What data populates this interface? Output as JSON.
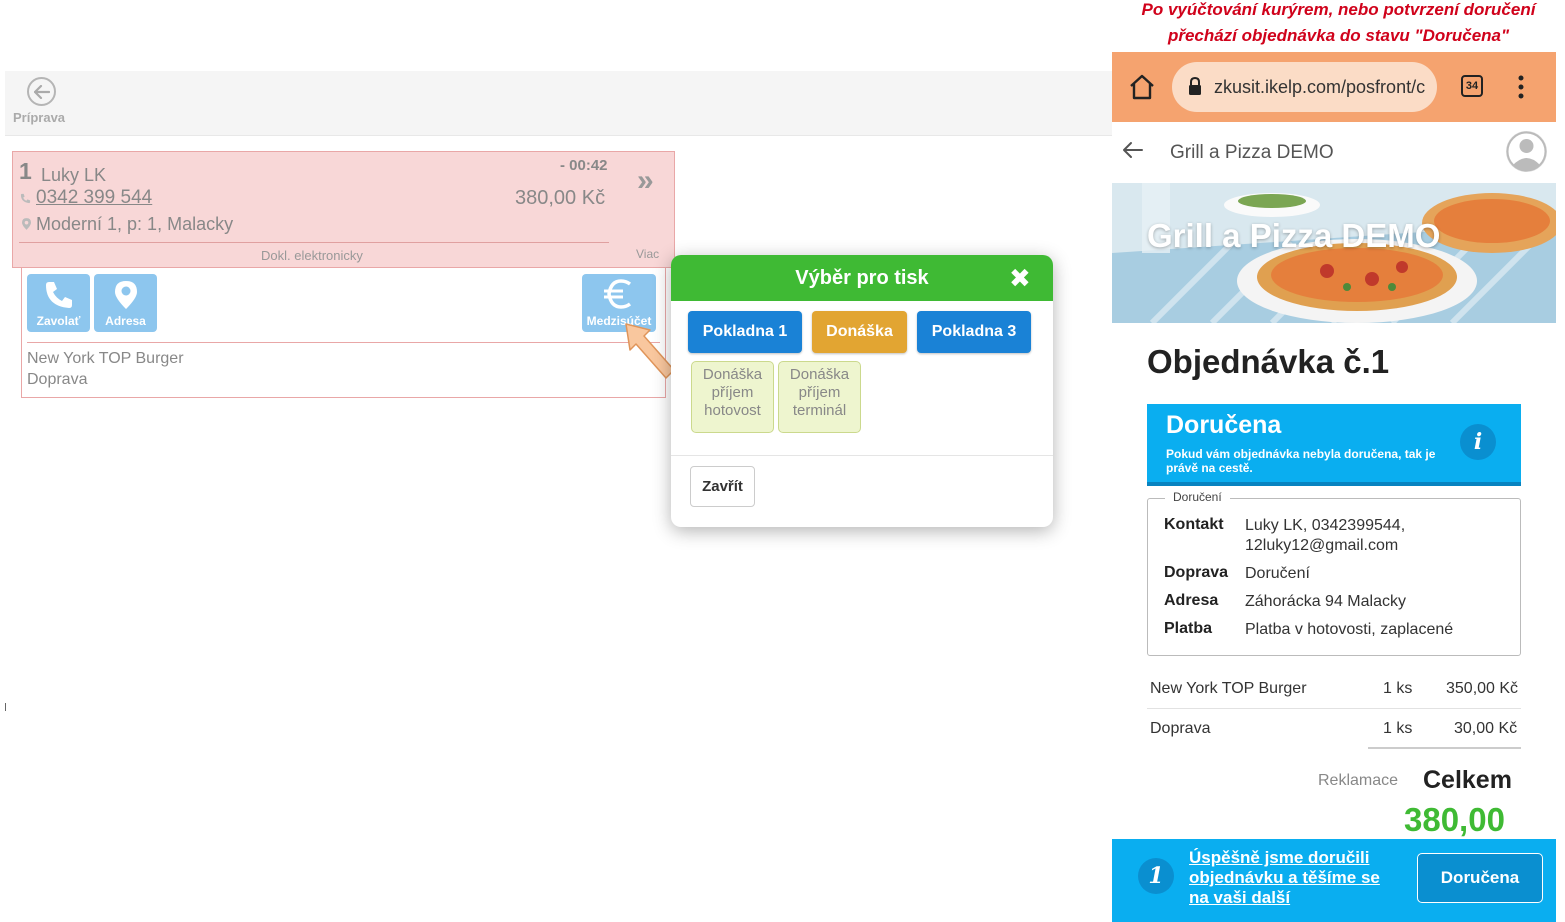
{
  "pos": {
    "back_label": "Príprava",
    "order": {
      "number": "1",
      "name": "Luky LK",
      "time": "- 00:42",
      "phone": "0342 399 544",
      "price": "380,00 Kč",
      "address": "Moderní 1, p: 1, Malacky",
      "doc": "Dokl. elektronicky",
      "more": "Viac",
      "chevron": "»"
    },
    "tiles": {
      "call": "Zavolať",
      "address": "Adresa",
      "subtotal": "Medzisúčet"
    },
    "items": [
      "New York TOP Burger",
      "Doprava"
    ]
  },
  "modal": {
    "title": "Výběr pro tisk",
    "close_icon": "✖",
    "buttons": [
      "Pokladna 1",
      "Donáška",
      "Pokladna 3"
    ],
    "options": [
      [
        "Donáška",
        "příjem",
        "hotovost"
      ],
      [
        "Donáška",
        "příjem",
        "terminál"
      ]
    ],
    "close_label": "Zavřít",
    "colors": {
      "header": "#3fba34",
      "blue": "#1a82d6",
      "orange": "#e2a532"
    }
  },
  "mobile": {
    "note_line1": "Po vyúčtování kurýrem, nebo potvrzení doručení",
    "note_line2": "přechází objednávka do stavu \"Doručena\"",
    "url": "zkusit.ikelp.com/posfront/c",
    "tabs_count": "34",
    "app_title": "Grill a Pizza DEMO",
    "banner_title": "Grill a Pizza DEMO",
    "order_title": "Objednávka č.1",
    "status": {
      "title": "Doručena",
      "subtitle": "Pokud vám objednávka nebyla doručena, tak je právě na cestě.",
      "info_icon": "i"
    },
    "delivery": {
      "legend": "Doručení",
      "rows": [
        {
          "label": "Kontakt",
          "value1": "Luky LK, 0342399544,",
          "value2": "12luky12@gmail.com"
        },
        {
          "label": "Doprava",
          "value1": "Doručení",
          "value2": ""
        },
        {
          "label": "Adresa",
          "value1": "Záhorácka 94 Malacky",
          "value2": ""
        },
        {
          "label": "Platba",
          "value1": "Platba v hotovosti, zaplacené",
          "value2": ""
        }
      ]
    },
    "items": [
      {
        "name": "New York TOP Burger",
        "qty": "1 ks",
        "price": "350,00 Kč"
      },
      {
        "name": "Doprava",
        "qty": "1 ks",
        "price": "30,00 Kč"
      }
    ],
    "reklamace": "Reklamace",
    "celkem": "Celkem",
    "total": "380,00",
    "footer": {
      "icon": "1",
      "text": "Úspěšně jsme doručili objednávku a těšíme se na vaši další",
      "button": "Doručena"
    },
    "colors": {
      "chrome": "#f5a36f",
      "status": "#0aaef0",
      "total": "#3fba34",
      "note": "#d0021b"
    }
  }
}
